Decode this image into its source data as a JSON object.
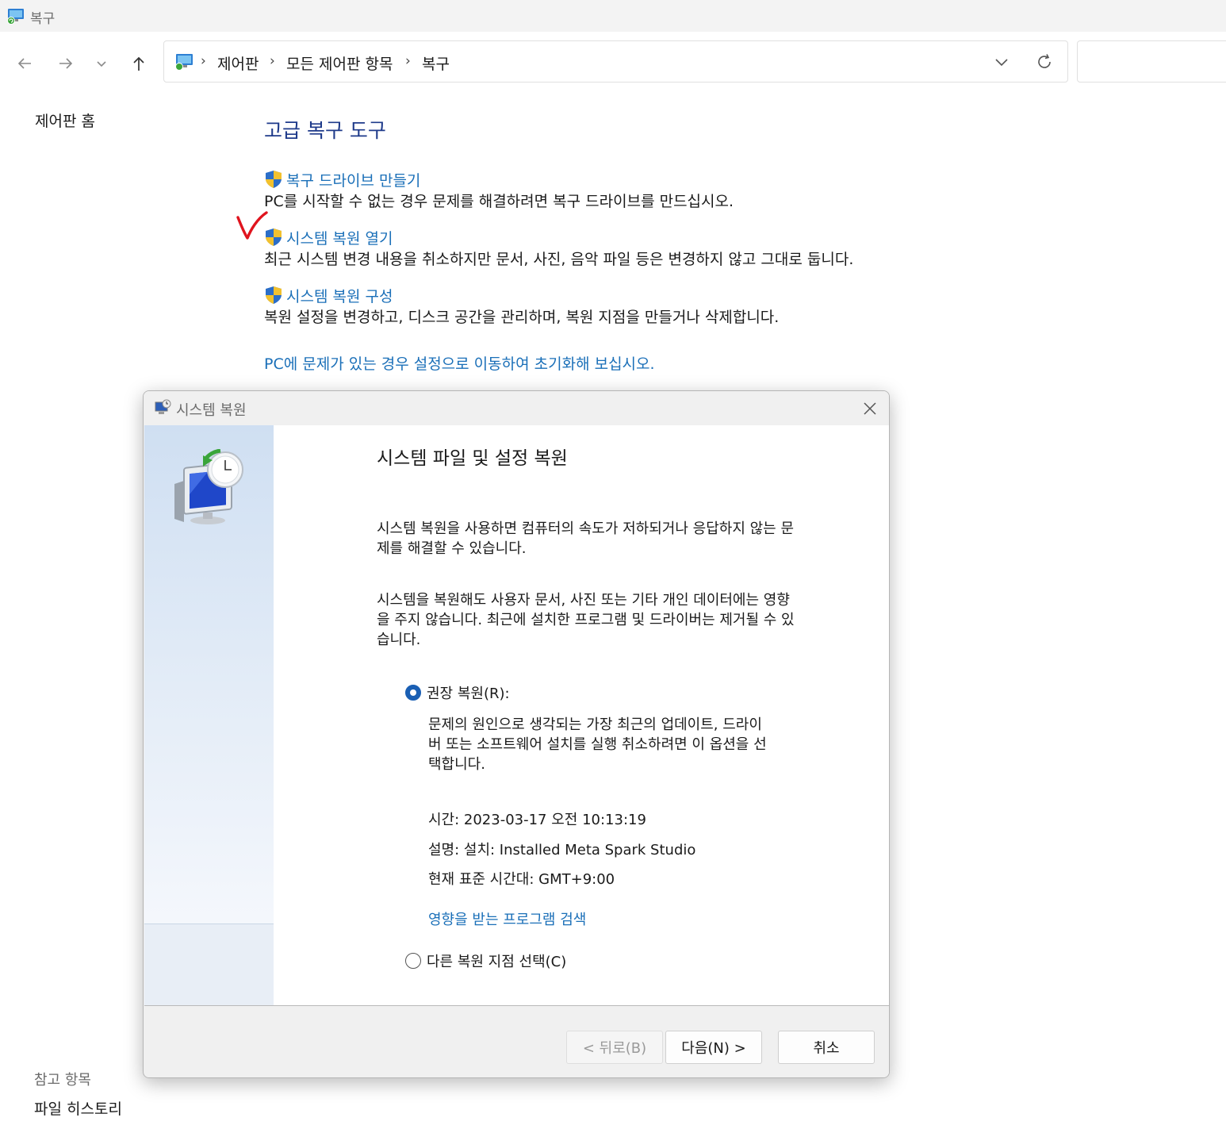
{
  "window": {
    "title": "복구"
  },
  "nav": {
    "breadcrumbs": [
      "제어판",
      "모든 제어판 항목",
      "복구"
    ],
    "separator": "›"
  },
  "left_pane": {
    "home": "제어판 홈",
    "see_also": "참고 항목",
    "file_history": "파일 히스토리"
  },
  "main": {
    "heading": "고급 복구 도구",
    "tools": [
      {
        "link": "복구 드라이브 만들기",
        "desc": "PC를 시작할 수 없는 경우 문제를 해결하려면 복구 드라이브를 만드십시오."
      },
      {
        "link": "시스템 복원 열기",
        "desc": "최근 시스템 변경 내용을 취소하지만 문서, 사진, 음악 파일 등은 변경하지 않고 그대로 둡니다."
      },
      {
        "link": "시스템 복원 구성",
        "desc": "복원 설정을 변경하고, 디스크 공간을 관리하며, 복원 지점을 만들거나 삭제합니다."
      }
    ],
    "reset_link": "PC에 문제가 있는 경우 설정으로 이동하여 초기화해 보십시오."
  },
  "dialog": {
    "title": "시스템 복원",
    "heading": "시스템 파일 및 설정 복원",
    "para1_line1": "시스템 복원을 사용하면 컴퓨터의 속도가 저하되거나 응답하지 않는 문",
    "para1_line2": "제를 해결할 수 있습니다.",
    "para2_line1": "시스템을 복원해도 사용자 문서, 사진 또는 기타 개인 데이터에는 영향",
    "para2_line2": "을 주지 않습니다. 최근에 설치한 프로그램 및 드라이버는 제거될 수 있",
    "para2_line3": "습니다.",
    "recommended": {
      "label": "권장 복원(R):",
      "selected": true,
      "desc_line1": "문제의 원인으로 생각되는 가장 최근의 업데이트, 드라이",
      "desc_line2": "버 또는 소프트웨어 설치를 실행 취소하려면 이 옵션을 선",
      "desc_line3": "택합니다.",
      "time": "시간: 2023-03-17 오전 10:13:19",
      "description": "설명: 설치: Installed Meta Spark Studio",
      "timezone": "현재 표준 시간대: GMT+9:00",
      "scan_link": "영향을 받는 프로그램 검색"
    },
    "other": {
      "label": "다른 복원 지점 선택(C)",
      "selected": false
    },
    "buttons": {
      "back": "< 뒤로(B)",
      "next": "다음(N) >",
      "cancel": "취소"
    }
  },
  "colors": {
    "link": "#1a6fb8",
    "heading": "#1e3a8a",
    "annotation_check": "#e0141e",
    "radio_selected": "#1a5fb4"
  }
}
